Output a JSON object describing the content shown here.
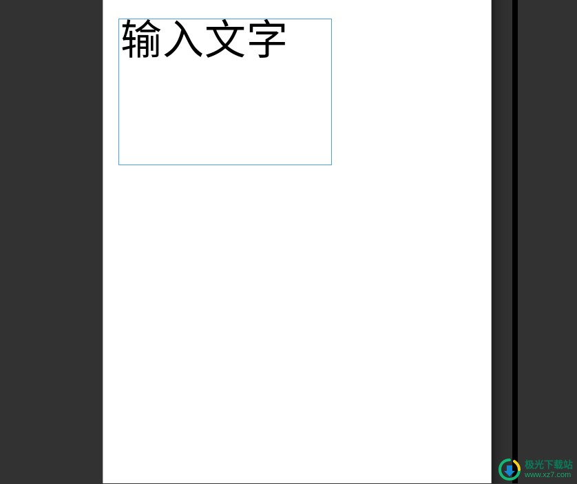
{
  "editor": {
    "text_frame": {
      "placeholder": "输入文字"
    }
  },
  "watermark": {
    "title": "极光下载站",
    "url": "www.xz7.com"
  }
}
